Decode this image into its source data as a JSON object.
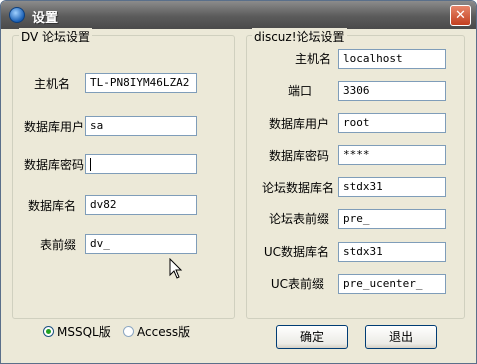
{
  "window": {
    "title": "设置",
    "close_glyph": "✕"
  },
  "dv_group": {
    "legend": "DV 论坛设置",
    "fields": [
      {
        "label": "主机名",
        "value": "TL-PN8IYM46LZA2"
      },
      {
        "label": "数据库用户",
        "value": "sa"
      },
      {
        "label": "数据库密码",
        "value": ""
      },
      {
        "label": "数据库名",
        "value": "dv82"
      },
      {
        "label": "表前缀",
        "value": "dv_"
      }
    ]
  },
  "discuz_group": {
    "legend": "discuz!论坛设置",
    "fields": [
      {
        "label": "主机名",
        "value": "localhost"
      },
      {
        "label": "端口",
        "value": "3306"
      },
      {
        "label": "数据库用户",
        "value": "root"
      },
      {
        "label": "数据库密码",
        "value": "****"
      },
      {
        "label": "论坛数据库名",
        "value": "stdx31"
      },
      {
        "label": "论坛表前缀",
        "value": "pre_"
      },
      {
        "label": "UC数据库名",
        "value": "stdx31"
      },
      {
        "label": "UC表前缀",
        "value": "pre_ucenter_"
      }
    ]
  },
  "db_type": {
    "options": [
      {
        "label": "MSSQL版",
        "selected": true
      },
      {
        "label": "Access版",
        "selected": false
      }
    ]
  },
  "buttons": {
    "ok": "确定",
    "exit": "退出"
  },
  "icons": {
    "app": "app-orb-icon",
    "close": "close-icon",
    "pointer": "mouse-cursor-icon"
  }
}
